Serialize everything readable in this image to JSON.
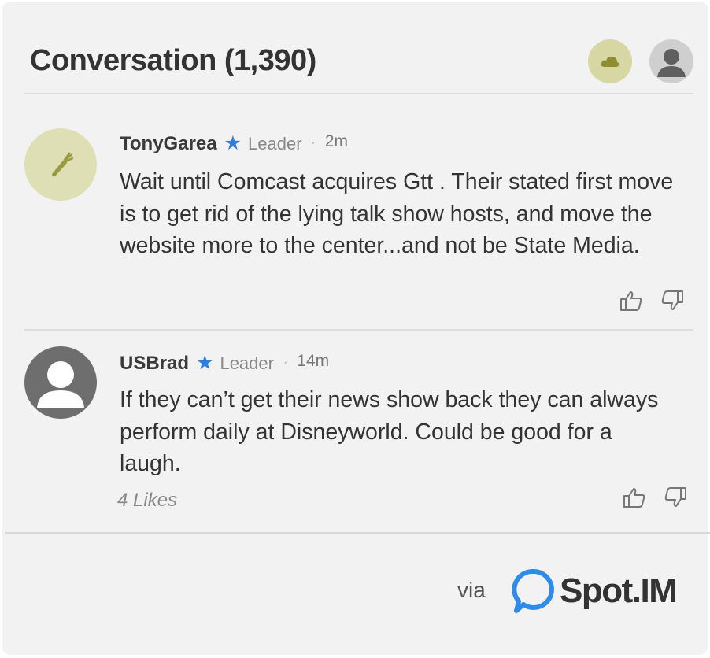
{
  "header": {
    "title": "Conversation (1,390)"
  },
  "comments": [
    {
      "username": "TonyGarea",
      "badge": "Leader",
      "separator": "·",
      "time": "2m",
      "avatar_icon": "carrot-icon",
      "text": "Wait until Comcast acquires Gtt .  Their stated first move is to get rid of the lying talk show hosts, and move the website more to the center...and not be State Media."
    },
    {
      "username": "USBrad",
      "badge": "Leader",
      "separator": "·",
      "time": "14m",
      "avatar_icon": "default-user-icon",
      "text": "If they can’t get their news show back they can always perform daily at Disneyworld. Could be good for a laugh.",
      "likes": "4 Likes"
    }
  ],
  "footer": {
    "via": "via",
    "brand": "Spot.IM"
  },
  "colors": {
    "leader_star": "#2f7fe0",
    "brand_blue": "#2f8be8",
    "avatar_green": "#dedfb4",
    "carrot": "#9a9a3e"
  }
}
